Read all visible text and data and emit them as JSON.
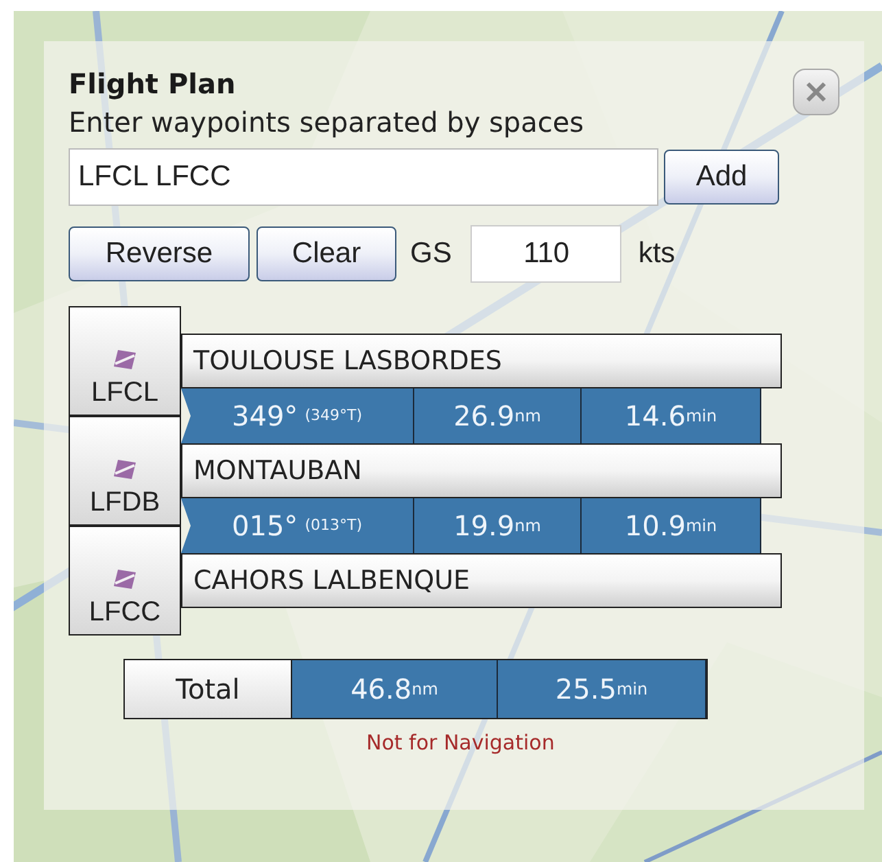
{
  "panel": {
    "title": "Flight Plan",
    "instructions": "Enter waypoints separated by spaces"
  },
  "waypoint_input": {
    "value": "LFCL LFCC"
  },
  "add_button": "Add",
  "reverse_button": "Reverse",
  "clear_button": "Clear",
  "ground_speed": {
    "label": "GS",
    "value": "110",
    "unit": "kts"
  },
  "waypoints": [
    {
      "code": "LFCL",
      "name": "TOULOUSE LASBORDES"
    },
    {
      "code": "LFDB",
      "name": "MONTAUBAN"
    },
    {
      "code": "LFCC",
      "name": "CAHORS LALBENQUE"
    }
  ],
  "legs": [
    {
      "heading": "349°",
      "true_heading": "(349°T)",
      "distance": "26.9",
      "distance_unit": "nm",
      "time": "14.6",
      "time_unit": "min"
    },
    {
      "heading": "015°",
      "true_heading": "(013°T)",
      "distance": "19.9",
      "distance_unit": "nm",
      "time": "10.9",
      "time_unit": "min"
    }
  ],
  "total": {
    "label": "Total",
    "distance": "46.8",
    "distance_unit": "nm",
    "time": "25.5",
    "time_unit": "min"
  },
  "disclaimer": "Not for Navigation"
}
